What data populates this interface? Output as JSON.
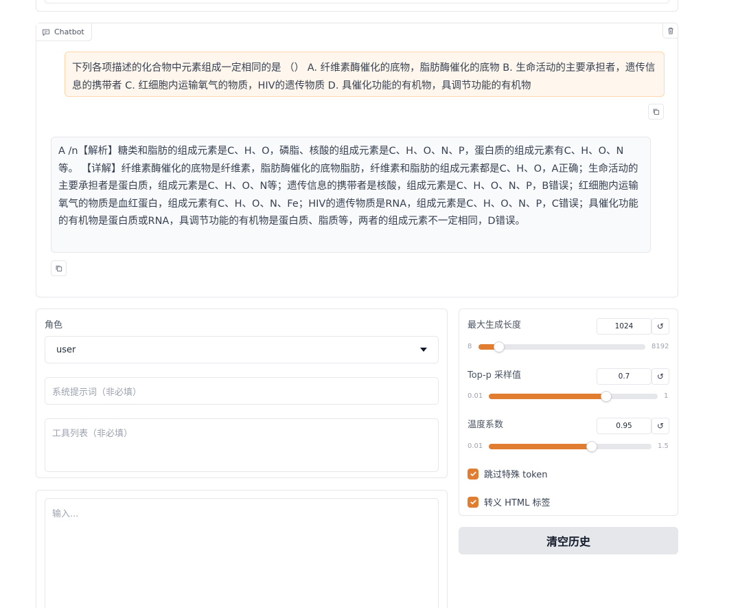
{
  "chatbot": {
    "label": "Chatbot",
    "messages": [
      {
        "role": "user",
        "text": "下列各项描述的化合物中元素组成一定相同的是 （） A. 纤维素酶催化的底物，脂肪酶催化的底物 B. 生命活动的主要承担者，遗传信息的携带者 C. 红细胞内运输氧气的物质，HIV的遗传物质 D. 具催化功能的有机物，具调节功能的有机物"
      },
      {
        "role": "assistant",
        "text": "A /n【解析】糖类和脂肪的组成元素是C、H、O，磷脂、核酸的组成元素是C、H、O、N、P，蛋白质的组成元素有C、H、O、N等。 【详解】纤维素酶催化的底物是纤维素，脂肪酶催化的底物脂肪，纤维素和脂肪的组成元素都是C、H、O，A正确；生命活动的主要承担者是蛋白质，组成元素是C、H、O、N等；遗传信息的携带者是核酸，组成元素是C、H、O、N、P，B错误；红细胞内运输氧气的物质是血红蛋白，组成元素有C、H、O、N、Fe；HIV的遗传物质是RNA，组成元素是C、H、O、N、P，C错误；具催化功能的有机物是蛋白质或RNA，具调节功能的有机物是蛋白质、脂质等，两者的组成元素不一定相同，D错误。"
      }
    ]
  },
  "role": {
    "label": "角色",
    "value": "user"
  },
  "system_prompt": {
    "placeholder": "系统提示词（非必填）"
  },
  "tools": {
    "placeholder": "工具列表（非必填）"
  },
  "input": {
    "placeholder": "输入..."
  },
  "sliders": [
    {
      "label": "最大生成长度",
      "value": "1024",
      "min": "8",
      "max": "8192",
      "fraction": 0.124
    },
    {
      "label": "Top-p 采样值",
      "value": "0.7",
      "min": "0.01",
      "max": "1",
      "fraction": 0.697
    },
    {
      "label": "温度系数",
      "value": "0.95",
      "min": "0.01",
      "max": "1.5",
      "fraction": 0.631
    }
  ],
  "checkboxes": [
    {
      "label": "跳过特殊 token",
      "checked": true
    },
    {
      "label": "转义 HTML 标签",
      "checked": true
    }
  ],
  "clear_button": {
    "label": "清空历史"
  },
  "colors": {
    "accent": "#e07d30",
    "user_bubble": "#fff7ed",
    "user_border": "#fed7aa",
    "bot_bubble": "#f9fafb"
  },
  "icons": {
    "chat": "chat-bubble-icon",
    "delete": "trash-icon",
    "copy": "copy-icon",
    "reset": "reset-icon",
    "dropdown": "chevron-down-icon",
    "check": "checkmark-icon"
  }
}
